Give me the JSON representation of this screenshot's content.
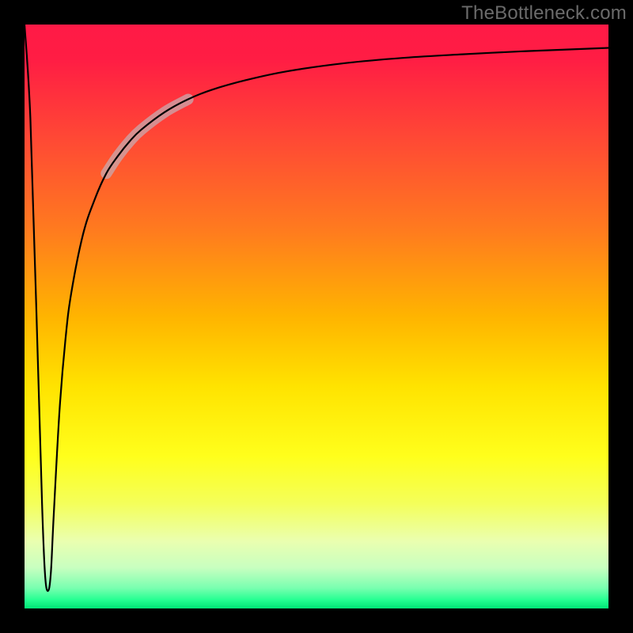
{
  "watermark": "TheBottleneck.com",
  "colors": {
    "gradient_stops": [
      {
        "offset": 0.0,
        "color": "#ff1a46"
      },
      {
        "offset": 0.06,
        "color": "#ff1d44"
      },
      {
        "offset": 0.2,
        "color": "#ff4a34"
      },
      {
        "offset": 0.35,
        "color": "#ff7a1f"
      },
      {
        "offset": 0.5,
        "color": "#ffb400"
      },
      {
        "offset": 0.62,
        "color": "#ffe300"
      },
      {
        "offset": 0.74,
        "color": "#ffff1c"
      },
      {
        "offset": 0.82,
        "color": "#f4ff5a"
      },
      {
        "offset": 0.885,
        "color": "#eaffb0"
      },
      {
        "offset": 0.93,
        "color": "#c8ffc0"
      },
      {
        "offset": 0.965,
        "color": "#79ffb0"
      },
      {
        "offset": 0.985,
        "color": "#26ff92"
      },
      {
        "offset": 1.0,
        "color": "#00e476"
      }
    ],
    "curve": "#000000",
    "highlight": "rgba(200,170,175,0.75)"
  },
  "chart_data": {
    "type": "line",
    "title": "",
    "xlabel": "",
    "ylabel": "",
    "xlim": [
      0,
      100
    ],
    "ylim": [
      0,
      100
    ],
    "series": [
      {
        "name": "bottleneck-curve",
        "x": [
          0.0,
          1.0,
          2.0,
          3.0,
          3.5,
          4.0,
          4.5,
          5.0,
          6.0,
          7.0,
          8.0,
          10.0,
          12.0,
          14.0,
          16.0,
          18.0,
          20.0,
          24.0,
          28.0,
          32.0,
          38.0,
          45.0,
          55.0,
          65.0,
          75.0,
          85.0,
          95.0,
          100.0
        ],
        "values": [
          100.0,
          84.0,
          52.0,
          18.0,
          6.0,
          3.0,
          6.0,
          16.0,
          34.0,
          46.0,
          54.0,
          64.0,
          70.0,
          74.5,
          77.5,
          80.0,
          82.0,
          85.0,
          87.2,
          88.8,
          90.5,
          92.0,
          93.4,
          94.3,
          94.9,
          95.4,
          95.8,
          96.0
        ]
      }
    ],
    "highlight_segment": {
      "x_start": 16.0,
      "x_end": 24.0
    },
    "annotations": []
  }
}
